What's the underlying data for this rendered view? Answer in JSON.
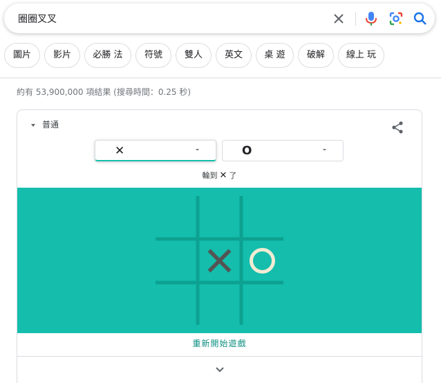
{
  "search": {
    "query": "圈圈叉叉"
  },
  "icons": {
    "clear": "close-icon",
    "mic": "microphone-icon",
    "lens": "google-lens-icon",
    "search": "search-icon",
    "share": "share-icon",
    "expand": "chevron-down-icon"
  },
  "chips": [
    {
      "label": "圖片"
    },
    {
      "label": "影片"
    },
    {
      "label": "必勝 法"
    },
    {
      "label": "符號"
    },
    {
      "label": "雙人"
    },
    {
      "label": "英文"
    },
    {
      "label": "桌 遊"
    },
    {
      "label": "破解"
    },
    {
      "label": "線上 玩"
    }
  ],
  "result_stats": "約有 53,900,000 項結果 (搜尋時間：0.25 秒)",
  "game": {
    "difficulty": "普通",
    "score_x": {
      "mark": "✕",
      "value": "-"
    },
    "score_o": {
      "mark": "O",
      "value": "-"
    },
    "turn_prefix": "輪到",
    "turn_mark": "✕",
    "turn_suffix": "了",
    "board": [
      "",
      "",
      "",
      "",
      "X",
      "O",
      "",
      "",
      ""
    ],
    "restart_label": "重新開始遊戲"
  },
  "colors": {
    "board": "#14bdac",
    "grid": "#0da192",
    "x_mark": "#545454",
    "o_mark": "#f2ebd3",
    "mic_blue": "#4285f4",
    "mic_red": "#ea4335",
    "search_blue": "#1a73e8"
  }
}
